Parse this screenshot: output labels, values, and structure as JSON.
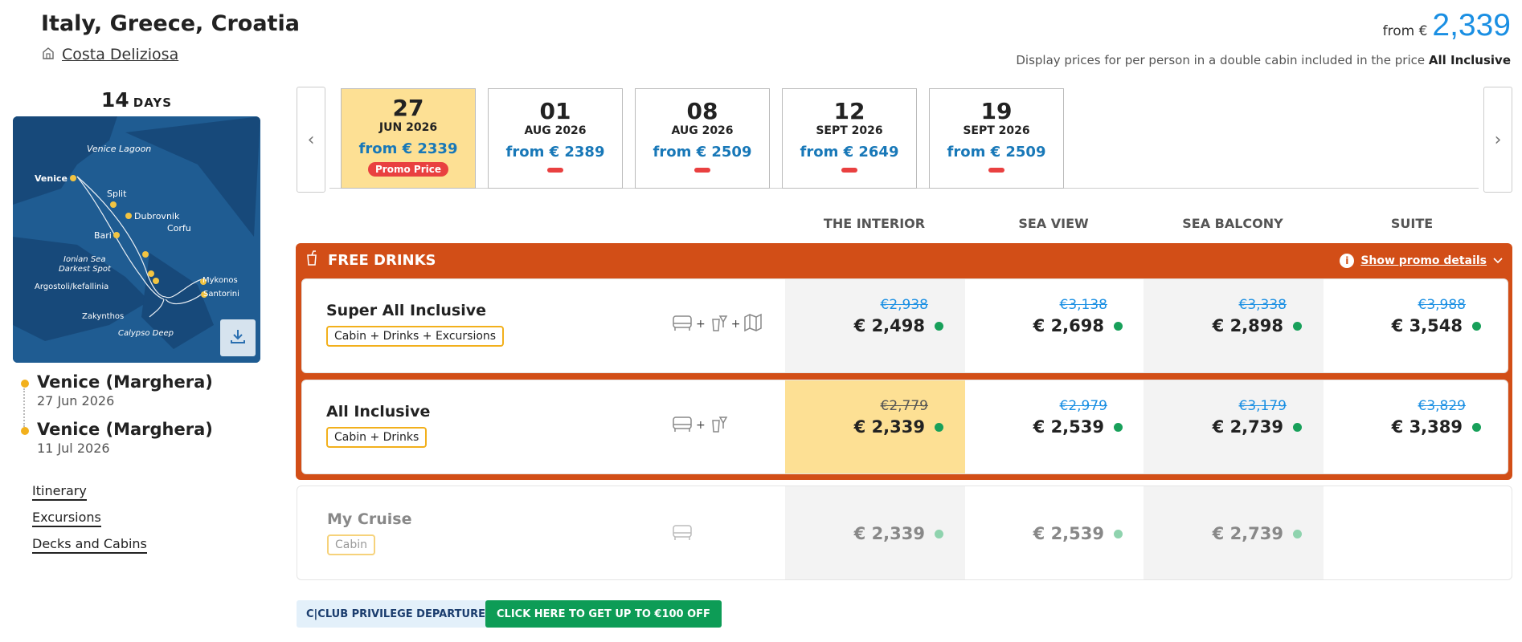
{
  "header": {
    "title": "Italy, Greece, Croatia",
    "ship": "Costa Deliziosa",
    "from_label": "from €",
    "from_value": "2,339",
    "price_note": "Display prices for per person in a double cabin included in the price",
    "price_note_bold": "All Inclusive"
  },
  "cruise": {
    "days_num": "14",
    "days_unit": "DAYS",
    "map_labels": [
      "Venice Lagoon",
      "Venice",
      "Split",
      "Dubrovnik",
      "Corfu",
      "Bari",
      "Ionian Sea",
      "Darkest Spot",
      "Argostoli/kefallinia",
      "Mykonos",
      "Santorini",
      "Zakynthos",
      "Calypso Deep"
    ]
  },
  "ports": [
    {
      "name": "Venice (Marghera)",
      "date": "27 Jun 2026"
    },
    {
      "name": "Venice (Marghera)",
      "date": "11 Jul 2026"
    }
  ],
  "links": [
    "Itinerary",
    "Excursions",
    "Decks and Cabins"
  ],
  "dates": [
    {
      "day": "27",
      "month": "JUN 2026",
      "price": "from € 2339",
      "promo": "Promo Price"
    },
    {
      "day": "01",
      "month": "AUG 2026",
      "price": "from € 2389"
    },
    {
      "day": "08",
      "month": "AUG 2026",
      "price": "from € 2509"
    },
    {
      "day": "12",
      "month": "SEPT 2026",
      "price": "from € 2649"
    },
    {
      "day": "19",
      "month": "SEPT 2026",
      "price": "from € 2509"
    }
  ],
  "categories": [
    "THE INTERIOR",
    "SEA VIEW",
    "SEA BALCONY",
    "SUITE"
  ],
  "promo": {
    "title": "FREE DRINKS",
    "details_link": "Show promo details"
  },
  "packages": [
    {
      "name": "Super All Inclusive",
      "tag": "Cabin + Drinks + Excursions",
      "prices": [
        {
          "old": "€2,938",
          "cur": "€ 2,498"
        },
        {
          "old": "€3,138",
          "cur": "€ 2,698"
        },
        {
          "old": "€3,338",
          "cur": "€ 2,898"
        },
        {
          "old": "€3,988",
          "cur": "€ 3,548"
        }
      ]
    },
    {
      "name": "All Inclusive",
      "tag": "Cabin + Drinks",
      "prices": [
        {
          "old": "€2,779",
          "cur": "€ 2,339"
        },
        {
          "old": "€2,979",
          "cur": "€ 2,539"
        },
        {
          "old": "€3,179",
          "cur": "€ 2,739"
        },
        {
          "old": "€3,829",
          "cur": "€ 3,389"
        }
      ]
    },
    {
      "name": "My Cruise",
      "tag": "Cabin",
      "prices": [
        {
          "cur": "€ 2,339"
        },
        {
          "cur": "€ 2,539"
        },
        {
          "cur": "€ 2,739"
        }
      ]
    }
  ],
  "buttons": {
    "club": "C|CLUB PRIVILEGE DEPARTURES",
    "offer": "CLICK HERE TO GET UP TO €100 OFF"
  },
  "colors": {
    "accent_blue": "#1a8fe3",
    "promo_orange": "#d24e17",
    "selected_yellow": "#fde094",
    "available_green": "#18a05a",
    "promo_red": "#e94040"
  }
}
